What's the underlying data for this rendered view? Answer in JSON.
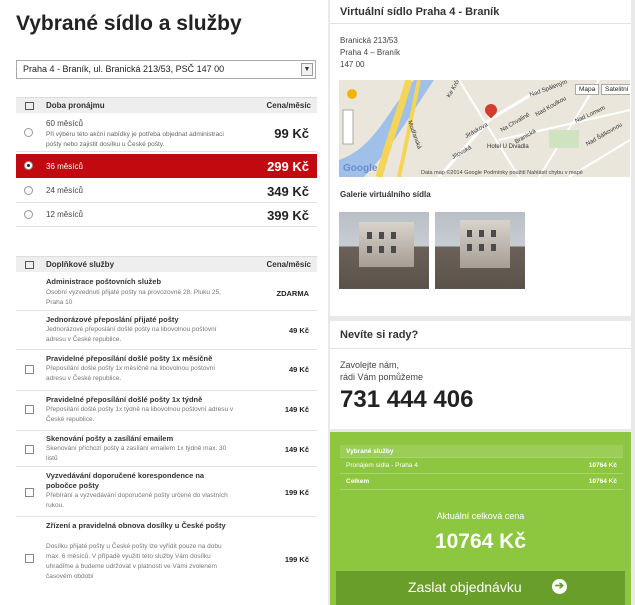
{
  "left": {
    "title": "Vybrané sídlo a služby",
    "address_select": "Praha 4 - Braník, ul. Branická 213/53, PSČ 147 00",
    "rental_header": {
      "label": "Doba pronájmu",
      "price": "Cena/měsíc"
    },
    "rental": [
      {
        "name": "60 měsíců",
        "note": "Při výběru této akční nabídky je potřeba objednat administraci pošty nebo zajistit dosílku u České pošty.",
        "price": "99 Kč",
        "selected": false
      },
      {
        "name": "36 měsíců",
        "note": "",
        "price": "299 Kč",
        "selected": true
      },
      {
        "name": "24 měsíců",
        "note": "",
        "price": "349 Kč",
        "selected": false
      },
      {
        "name": "12 měsíců",
        "note": "",
        "price": "399 Kč",
        "selected": false
      }
    ],
    "services_header": {
      "label": "Doplňkové služby",
      "price": "Cena/měsíc"
    },
    "services": [
      {
        "name": "Administrace poštovních služeb",
        "desc": "Osobní vyzvednutí přijaté pošty na provozovně 28. Pluku 25, Praha 10",
        "price": "ZDARMA",
        "checkbox": false
      },
      {
        "name": "Jednorázové přeposlání přijaté pošty",
        "desc": "Jednorázové přeposlání došlé pošty na libovolnou poštovní adresu v České republice.",
        "price": "49 Kč",
        "checkbox": false
      },
      {
        "name": "Pravidelné přeposílání došlé pošty 1x měsíčně",
        "desc": "Přeposílání došlé pošty 1x měsíčně na libovolnou poštovní adresu v České republice.",
        "price": "49 Kč",
        "checkbox": true
      },
      {
        "name": "Pravidelné přeposílání došlé pošty 1x týdně",
        "desc": "Přeposílání došlé pošty 1x týdně na libovolnou poštovní adresu v České republice.",
        "price": "149 Kč",
        "checkbox": true
      },
      {
        "name": "Skenování pošty a zasílání emailem",
        "desc": "Skenování příchozí pošty a zasílání emailem 1x týdně max. 30 listů",
        "price": "149 Kč",
        "checkbox": true
      },
      {
        "name": "Vyzvedávání doporučené korespondence na pobočce pošty",
        "desc": "Přebírání a vyzvedávání doporučené pošty určené do vlastních rukou.",
        "price": "199 Kč",
        "checkbox": true
      },
      {
        "name": "Zřízení a pravidelná obnova dosílky u České pošty",
        "desc": "Dosílku přijaté pošty u České pošty lze vyřídit pouze na dobu max. 6 měsíců. V případě využití této služby Vám dosílku uhradíme a budeme udržovat v platnosti ve Vámi zvoleném časovém období",
        "price": "199 Kč",
        "checkbox": true
      }
    ]
  },
  "right": {
    "title": "Virtuální sídlo Praha 4 - Braník",
    "address": [
      "Branická 213/53",
      "Praha 4 – Braník",
      "147 00"
    ],
    "map": {
      "btn_map": "Mapa",
      "btn_sat": "Satelitní",
      "credit": "Data map ©2014 Google   Podmínky použití   Nahlásit chybu v mapě",
      "logo": "Google",
      "labels": [
        "Ke Krči",
        "Hotel U Divadla",
        "Modřanská",
        "Jiráskova",
        "Nad Spáleným",
        "Branická",
        "Nad Koulkou",
        "Nad Lomem",
        "Nad Šálkovnou",
        "Jílovská",
        "Na Chvalině"
      ]
    },
    "gallery_title": "Galerie virtuálního sídla",
    "help": {
      "title": "Nevíte si rady?",
      "text1": "Zavolejte nám,",
      "text2": "rádi Vám pomůžeme",
      "phone": "731 444 406"
    },
    "summary": {
      "header": "Vybrané služby",
      "rows": [
        {
          "label": "Pronájem sídla - Praha 4",
          "value": "10764 Kč"
        },
        {
          "label": "Celkem",
          "value": "10764 Kč"
        }
      ],
      "caption": "Aktuální celková cena",
      "total": "10764 Kč",
      "order_button": "Zaslat objednávku",
      "order_arrow": "➔"
    }
  },
  "colors": {
    "accent_red": "#c1090f",
    "green": "#8dc63f",
    "green_dark": "#6a9e2b"
  }
}
